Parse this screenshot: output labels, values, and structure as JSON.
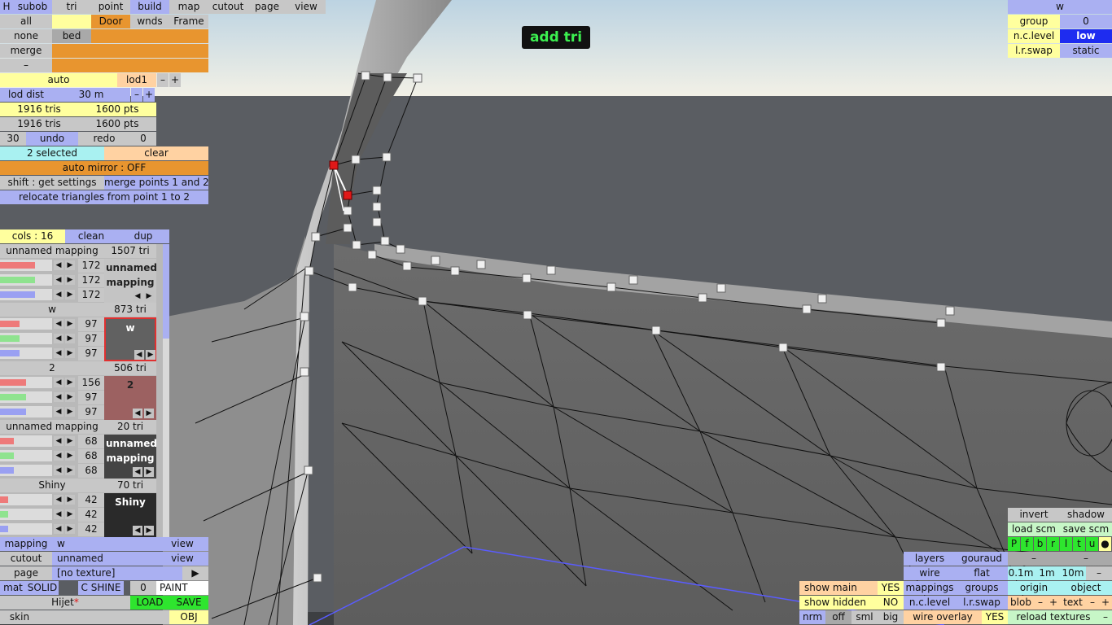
{
  "menu": {
    "h": "H",
    "subob": "subob",
    "tri": "tri",
    "point": "point",
    "build": "build",
    "map": "map",
    "cutout": "cutout",
    "page": "page",
    "view": "view"
  },
  "select": {
    "all": "all",
    "none": "none",
    "merge": "merge",
    "minus": "–",
    "bed": "bed",
    "door": "Door",
    "wnds": "wnds",
    "frame": "Frame"
  },
  "lod": {
    "auto": "auto",
    "lod1": "lod1",
    "minus": "–",
    "plus": "+",
    "dist_label": "lod dist",
    "dist_value": "30 m"
  },
  "stats": {
    "tris1": "1916 tris",
    "pts1": "1600 pts",
    "tris2": "1916 tris",
    "pts2": "1600 pts"
  },
  "history": {
    "count": "30",
    "undo": "undo",
    "redo": "redo",
    "redo_count": "0"
  },
  "selection": {
    "selected": "2 selected",
    "clear": "clear",
    "mirror": "auto mirror : OFF",
    "shift": "shift : get settings",
    "merge_points": "merge points 1 and 2",
    "relocate": "relocate triangles from point 1 to 2"
  },
  "mat_header": {
    "cols": "cols : 16",
    "clean": "clean",
    "dup": "dup"
  },
  "materials": [
    {
      "name": "unnamed mapping",
      "tris": "1507 tri",
      "rgb": [
        "172",
        "172",
        "172"
      ],
      "swatch": "unnamed mapping",
      "color": "#c4c4c4",
      "text_color": "#222222",
      "fill": 0.67
    },
    {
      "name": "w",
      "tris": "873 tri",
      "rgb": [
        "97",
        "97",
        "97"
      ],
      "swatch": "w",
      "color": "#616161",
      "text_color": "#ffffff",
      "fill": 0.38
    },
    {
      "name": "2",
      "tris": "506 tri",
      "rgb": [
        "156",
        "97",
        "97"
      ],
      "swatch": "2",
      "color": "#9c6161",
      "text_color": "#222222",
      "fill": 0.5
    },
    {
      "name": "unnamed mapping",
      "tris": "20 tri",
      "rgb": [
        "68",
        "68",
        "68"
      ],
      "swatch": "unnamed mapping",
      "color": "#444444",
      "text_color": "#ffffff",
      "fill": 0.27
    },
    {
      "name": "Shiny",
      "tris": "70 tri",
      "rgb": [
        "42",
        "42",
        "42"
      ],
      "swatch": "Shiny",
      "color": "#2a2a2a",
      "text_color": "#ffffff",
      "fill": 0.16
    }
  ],
  "bottom_left": {
    "mapping_label": "mapping",
    "mapping_value": "w",
    "view1": "view",
    "cutout_label": "cutout",
    "cutout_value": "unnamed",
    "view2": "view",
    "page_label": "page",
    "page_value": "[no texture]",
    "arrow": "▶",
    "mat": "mat",
    "solid": "SOLID",
    "cshine": "C SHINE",
    "zero": "0",
    "paint": "PAINT",
    "file": "Hijet",
    "star": "*",
    "load": "LOAD",
    "save": "SAVE",
    "skin": "skin",
    "obj": "OBJ"
  },
  "mode_label": "add tri",
  "top_right": {
    "w": "w",
    "group": "group",
    "group_val": "0",
    "nc_level": "n.c.level",
    "nc_val": "low",
    "lr_swap": "l.r.swap",
    "lr_val": "static"
  },
  "bottom_right": {
    "invert": "invert",
    "shadow": "shadow",
    "load_scm": "load scm",
    "save_scm": "save scm",
    "letters": [
      "P",
      "f",
      "b",
      "r",
      "l",
      "t",
      "u",
      "●"
    ],
    "dash1": "–",
    "dash2": "–",
    "layers": "layers",
    "gouraud": "gouraud",
    "wire": "wire",
    "flat": "flat",
    "d01": "0.1m",
    "d1": "1m",
    "d10": "10m",
    "dminus": "–",
    "mappings": "mappings",
    "groups": "groups",
    "origin": "origin",
    "object": "object",
    "show_main": "show main",
    "yes1": "YES",
    "show_hidden": "show hidden",
    "no": "NO",
    "nc_level": "n.c.level",
    "lr_swap": "l.r.swap",
    "blob": "blob",
    "bminus": "–",
    "bplus": "+",
    "text": "text",
    "tminus": "–",
    "tplus": "+",
    "nrm": "nrm",
    "off": "off",
    "sml": "sml",
    "big": "big",
    "wire_overlay": "wire overlay",
    "yes2": "YES",
    "reload": "reload textures",
    "rminus": "–"
  },
  "colors": {
    "sky_top": "#bfd6e4",
    "sky_bottom": "#f3f1e6",
    "ground": "#5a5d62",
    "selected_point": "#e01818",
    "mode_text": "#3cf050"
  }
}
